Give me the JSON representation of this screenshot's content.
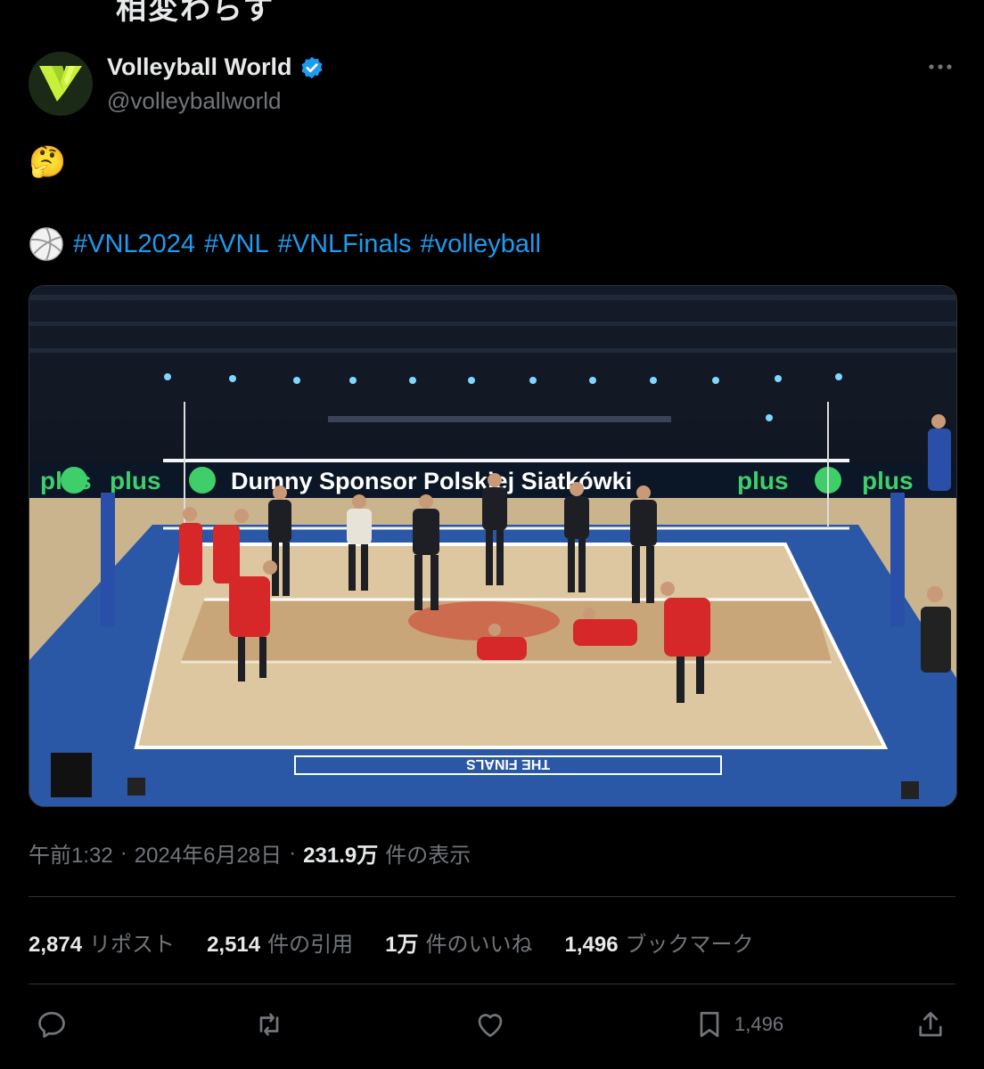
{
  "header_partial": "相変わらず",
  "tweet": {
    "display_name": "Volleyball World",
    "handle": "@volleyballworld",
    "emoji_line": "🤔",
    "hashtag_emoji": "volleyball-icon",
    "hashtags": [
      "#VNL2024",
      "#VNL",
      "#VNLFinals",
      "#volleyball"
    ],
    "more_icon": "more-dots-icon",
    "media": {
      "banner_text": "Dumny Sponsor Polskiej Siatkówki",
      "sponsor_word": "plus",
      "court_text": "THE FINALS"
    },
    "meta": {
      "time": "午前1:32",
      "date": "2024年6月28日",
      "views_count": "231.9万",
      "views_label": "件の表示",
      "sep": "·"
    },
    "stats": [
      {
        "num": "2,874",
        "label": "リポスト"
      },
      {
        "num": "2,514",
        "label": "件の引用"
      },
      {
        "num": "1万",
        "label": "件のいいね"
      },
      {
        "num": "1,496",
        "label": "ブックマーク"
      }
    ],
    "actions": {
      "bookmark_count": "1,496"
    }
  },
  "colors": {
    "background": "#000000",
    "link": "#1d9bf0",
    "muted": "#71767b",
    "verified": "#1d9bf0",
    "logo": "#c7f03a"
  }
}
